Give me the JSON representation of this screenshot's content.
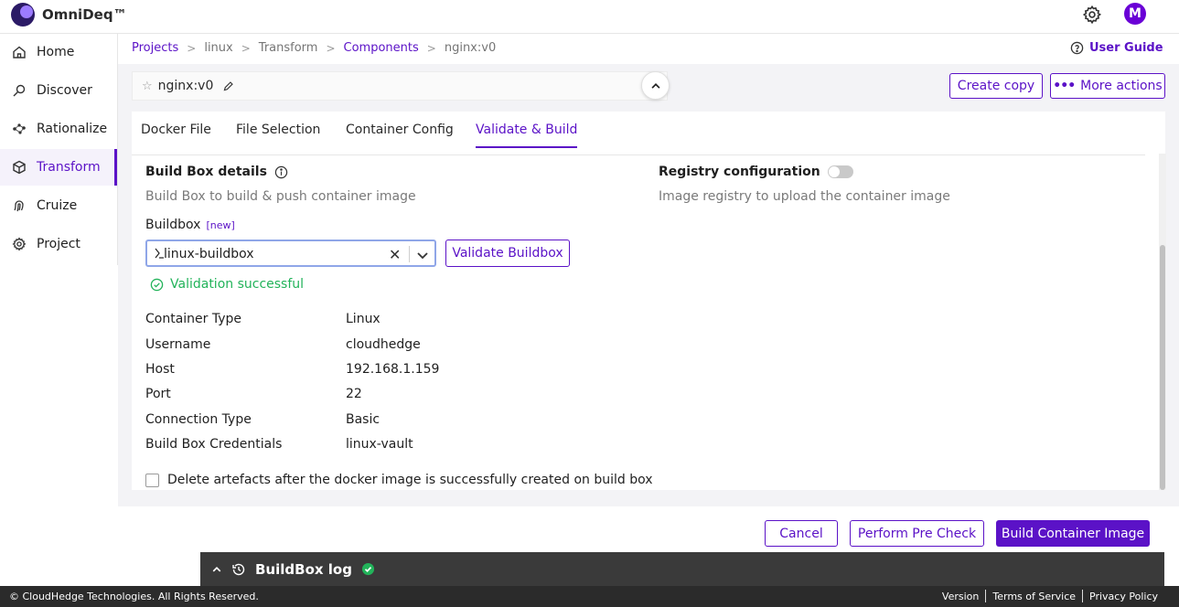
{
  "app": {
    "name": "OmniDeq™",
    "avatar_initial": "M",
    "accent": "#5b12c7"
  },
  "sidebar": {
    "items": [
      {
        "label": "Home",
        "icon": "home-icon"
      },
      {
        "label": "Discover",
        "icon": "discover-icon"
      },
      {
        "label": "Rationalize",
        "icon": "rationalize-icon"
      },
      {
        "label": "Transform",
        "icon": "cube-icon",
        "active": true
      },
      {
        "label": "Cruize",
        "icon": "fingerprint-icon"
      },
      {
        "label": "Project",
        "icon": "gear-icon"
      }
    ]
  },
  "breadcrumb": {
    "items": [
      "Projects",
      "linux",
      "Transform",
      "Components",
      "nginx:v0"
    ],
    "separator": ">"
  },
  "header": {
    "user_guide": "User Guide",
    "component_title": "nginx:v0",
    "create_copy": "Create copy",
    "more_actions": "More actions"
  },
  "tabs": [
    "Docker File",
    "File Selection",
    "Container Config",
    "Validate & Build"
  ],
  "buildbox": {
    "title": "Build Box details",
    "subtitle": "Build Box to build & push container image",
    "field_label": "Buildbox",
    "new_badge": "[new]",
    "selected_value": "linux-buildbox",
    "validate_button": "Validate Buildbox",
    "validation_message": "Validation successful",
    "validation_color": "#22b35a"
  },
  "registry": {
    "title": "Registry configuration",
    "subtitle": "Image registry to upload the container image",
    "enabled": false
  },
  "details": [
    {
      "label": "Container Type",
      "value": "Linux"
    },
    {
      "label": "Username",
      "value": "cloudhedge"
    },
    {
      "label": "Host",
      "value": "192.168.1.159"
    },
    {
      "label": "Port",
      "value": "22"
    },
    {
      "label": "Connection Type",
      "value": "Basic"
    },
    {
      "label": "Build Box Credentials",
      "value": "linux-vault"
    }
  ],
  "delete_artefacts": {
    "label": "Delete artefacts after the docker image is successfully created on build box",
    "checked": false
  },
  "actions": {
    "cancel": "Cancel",
    "precheck": "Perform Pre Check",
    "build": "Build Container Image"
  },
  "log": {
    "title": "BuildBox log"
  },
  "footer": {
    "copyright": "© CloudHedge Technologies. All Rights Reserved.",
    "links": [
      "Version",
      "Terms of Service",
      "Privacy Policy"
    ]
  }
}
